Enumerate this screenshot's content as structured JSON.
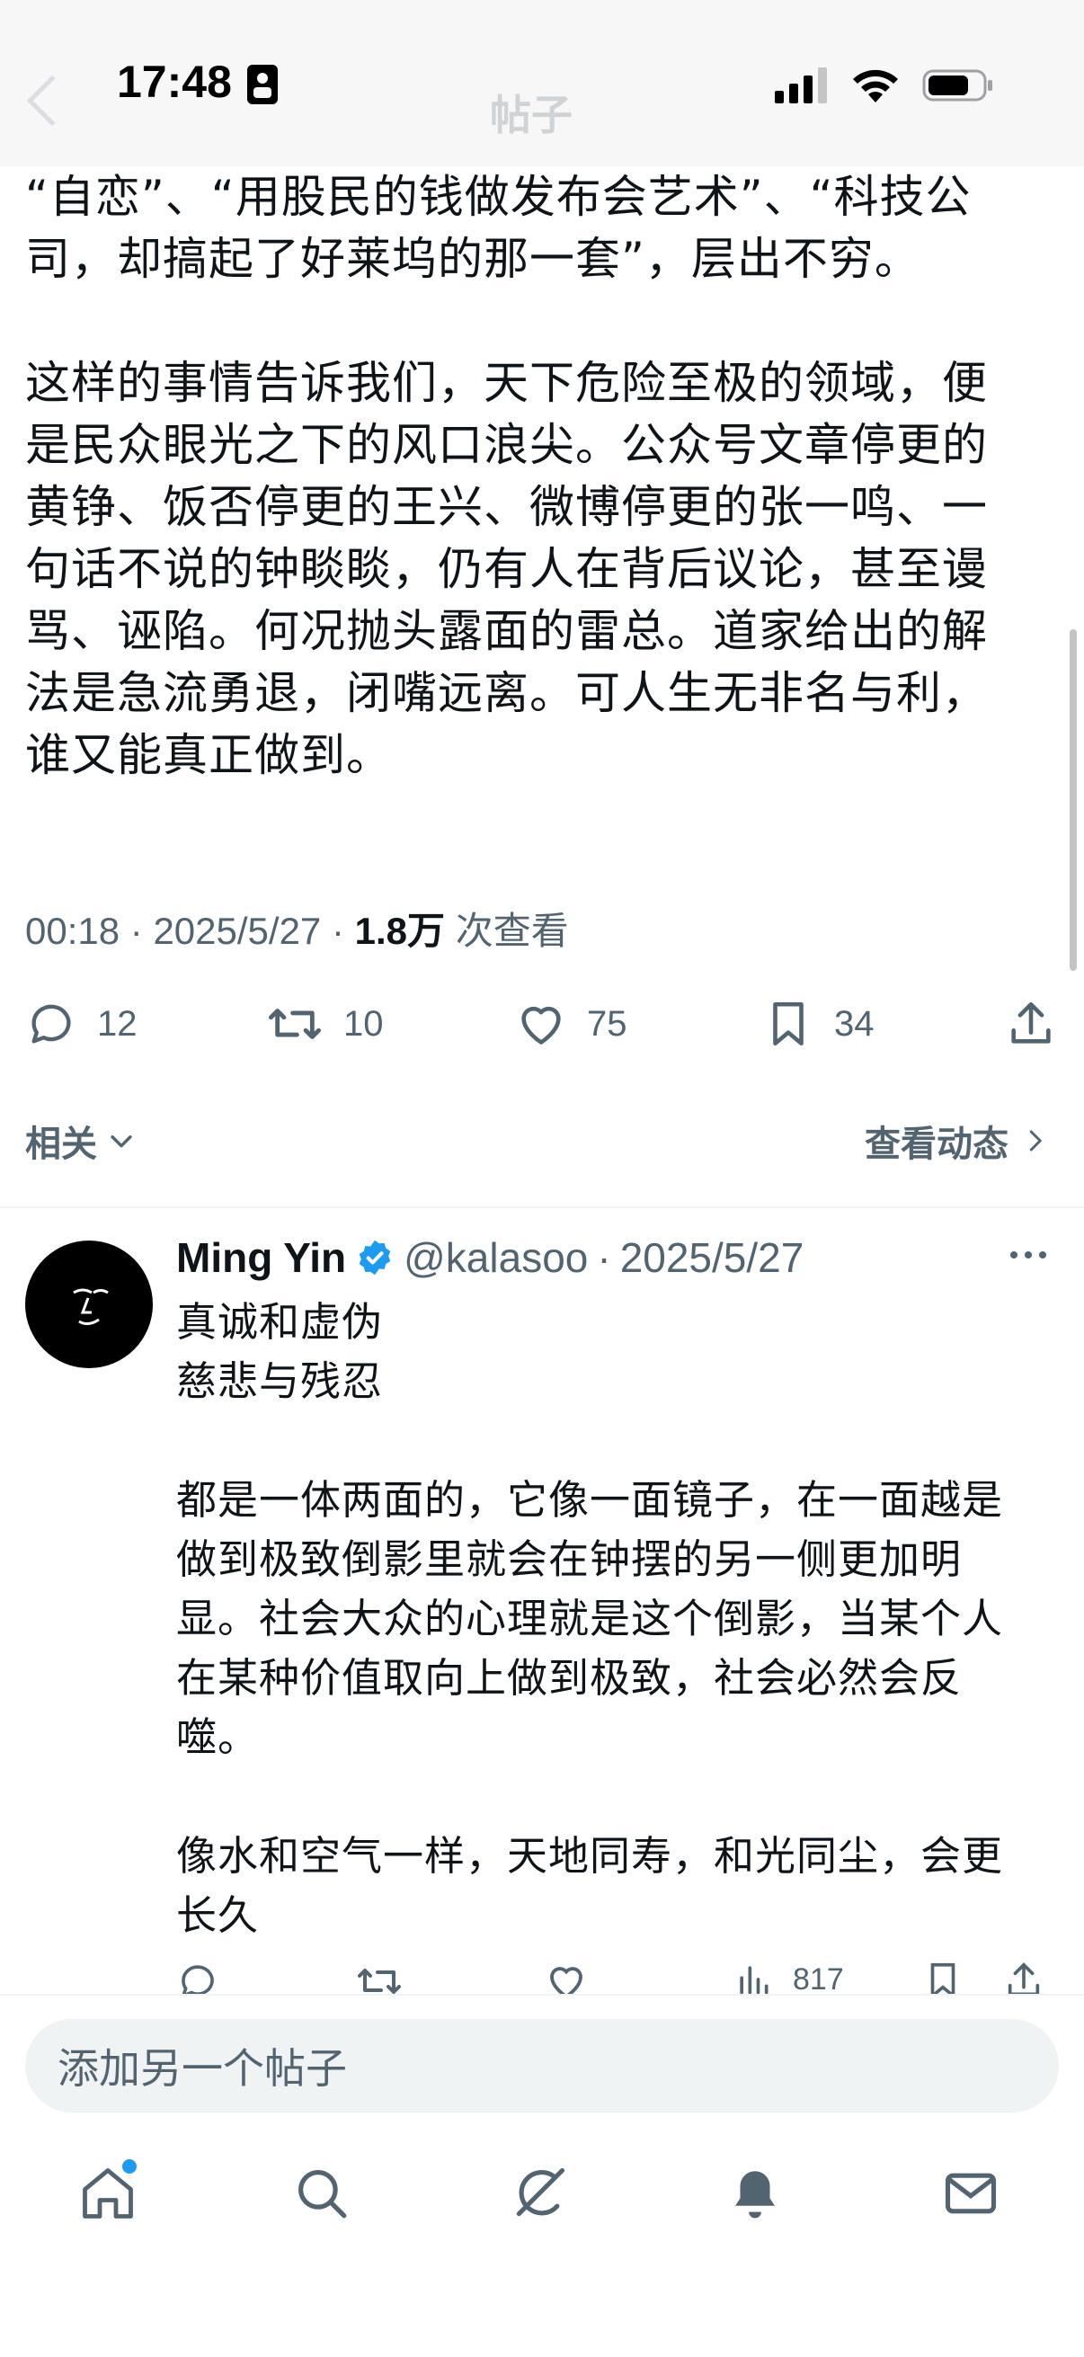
{
  "status_bar": {
    "time": "17:48"
  },
  "post": {
    "paragraphs": [
      "“自恋”、“用股民的钱做发布会艺术”、“科技公\n司，却搞起了好莱坞的那一套”，层出不穷。",
      "这样的事情告诉我们，天下危险至极的领域，便\n是民众眼光之下的风口浪尖。公众号文章停更的\n黄铮、饭否停更的王兴、微博停更的张一鸣、一\n句话不说的钟睒睒，仍有人在背后议论，甚至谩\n骂、诬陷。何况抛头露面的雷总。道家给出的解\n法是急流勇退，闭嘴远离。可人生无非名与利，\n谁又能真正做到。"
    ],
    "time": "00:18",
    "date": "2025/5/27",
    "views_count": "1.8万",
    "views_label": "次查看",
    "stats": {
      "replies": "12",
      "reposts": "10",
      "likes": "75",
      "bookmarks": "34"
    }
  },
  "related_label": "相关",
  "view_activity_label": "查看动态",
  "reply": {
    "name": "Ming Yin",
    "handle": "@kalasoo",
    "date": "2025/5/27",
    "paragraphs": [
      "真诚和虚伪\n慈悲与残忍",
      "都是一体两面的，它像一面镜子，在一面越是\n做到极致倒影里就会在钟摆的另一侧更加明\n显。社会大众的心理就是这个倒影，当某个人\n在某种价值取向上做到极致，社会必然会反\n噬。",
      "像水和空气一样，天地同寿，和光同尘，会更\n长久"
    ],
    "views": "817"
  },
  "composer": {
    "placeholder": "添加另一个帖子"
  },
  "colors": {
    "accent": "#1d9bf0",
    "secondary_text": "#536471",
    "primary_text": "#0f1419"
  },
  "icons": [
    "reply-icon",
    "repost-icon",
    "like-icon",
    "bookmark-icon",
    "share-icon",
    "home-icon",
    "search-icon",
    "grok-icon",
    "notifications-icon",
    "messages-icon"
  ]
}
